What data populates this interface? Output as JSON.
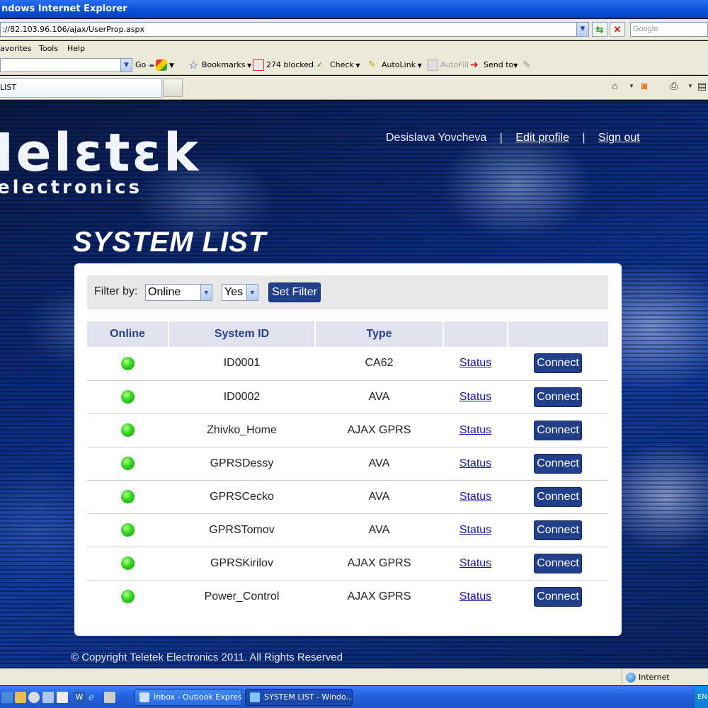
{
  "browser": {
    "title": "ndows Internet Explorer",
    "address": "://82.103.96.106/ajax/UserProp.aspx",
    "search_placeholder": "Google",
    "menu": [
      "avorites",
      "Tools",
      "Help"
    ],
    "toolbar": {
      "go": "Go",
      "bookmarks": "Bookmarks",
      "blocked": "274 blocked",
      "check": "Check",
      "autolink": "AutoLink",
      "autofill": "AutoFill",
      "sendto": "Send to"
    },
    "tab_label": "LIST"
  },
  "header": {
    "logo_main": "Ielɛtɛk",
    "logo_sub": "electronics",
    "user_name": "Desislava Yovcheva",
    "separator": "|",
    "edit_profile": "Edit profile",
    "sign_out": "Sign out"
  },
  "page_title": "SYSTEM LIST",
  "filter": {
    "label": "Filter by:",
    "field_value": "Online",
    "value": "Yes",
    "button": "Set Filter"
  },
  "table": {
    "columns": [
      "Online",
      "System ID",
      "Type",
      "",
      ""
    ],
    "status_label": "Status",
    "connect_label": "Connect",
    "online_color": "#2ed61d",
    "rows": [
      {
        "system_id": "ID0001",
        "type": "CA62"
      },
      {
        "system_id": "ID0002",
        "type": "AVA"
      },
      {
        "system_id": "Zhivko_Home",
        "type": "AJAX GPRS"
      },
      {
        "system_id": "GPRSDessy",
        "type": "AVA"
      },
      {
        "system_id": "GPRSCecko",
        "type": "AVA"
      },
      {
        "system_id": "GPRSTomov",
        "type": "AVA"
      },
      {
        "system_id": "GPRSKirilov",
        "type": "AJAX GPRS"
      },
      {
        "system_id": "Power_Control",
        "type": "AJAX GPRS"
      }
    ]
  },
  "footer": {
    "copyright": "© Copyright Teletek Electronics 2011. All Rights Reserved"
  },
  "statusbar": {
    "zone": "Internet"
  },
  "taskbar": {
    "items": [
      "Inbox - Outlook Express",
      "SYSTEM LIST - Windo..."
    ],
    "tray_text": "EN"
  }
}
